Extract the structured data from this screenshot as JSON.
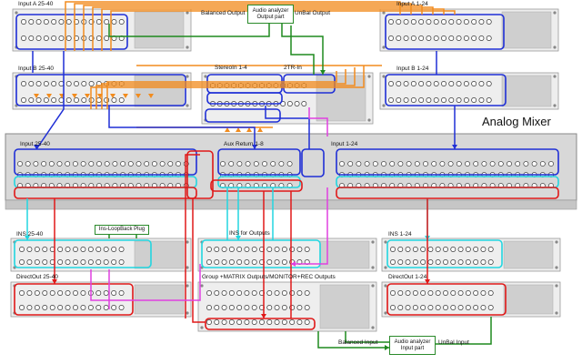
{
  "mixer": {
    "title": "Analog Mixer"
  },
  "racks": {
    "input_a_25_40": "Input A 25-40",
    "input_a_1_24": "Input A 1-24",
    "input_b_25_40": "Input B 25-40",
    "input_b_1_24": "Input B 1-24",
    "stereo_in": "StereoIn 1-4",
    "two_tr_in": "2TR-In",
    "ins_25_40": "INS 25-40",
    "ins_outputs": "INS for Outputs",
    "ins_1_24": "INS 1-24",
    "directout_25_40": "DirectOut 25-40",
    "group_outputs": "Group +MATRIX Outputs/MONITOR+REC Outputs",
    "directout_1_24": "DirectOut 1-24"
  },
  "mixer_sections": {
    "input_25_40": "Input 25-40",
    "aux_return": "Aux Return 1-8",
    "input_1_24": "Input 1-24"
  },
  "labels": {
    "balanced_output": "Balanced Output",
    "unbal_output": "UnBal Output",
    "balanced_input": "Balanced Input",
    "unbal_input": "UnBal Input",
    "analyzer_out_1": "Audio analyzer",
    "analyzer_out_2": "Output part",
    "analyzer_in_1": "Audio analyzer",
    "analyzer_in_2": "Input part",
    "ins_loopback": "Ins-LoopBack Plug"
  },
  "colors": {
    "orange": "#f28c1e",
    "blue": "#1f2fd6",
    "red": "#e01818",
    "cyan": "#22d6e0",
    "magenta": "#e040e0",
    "green": "#1f8a1f",
    "rack_face": "#eeeeee",
    "rack_edge": "#9a9a9a",
    "mixer_face": "#d8d8d8"
  }
}
